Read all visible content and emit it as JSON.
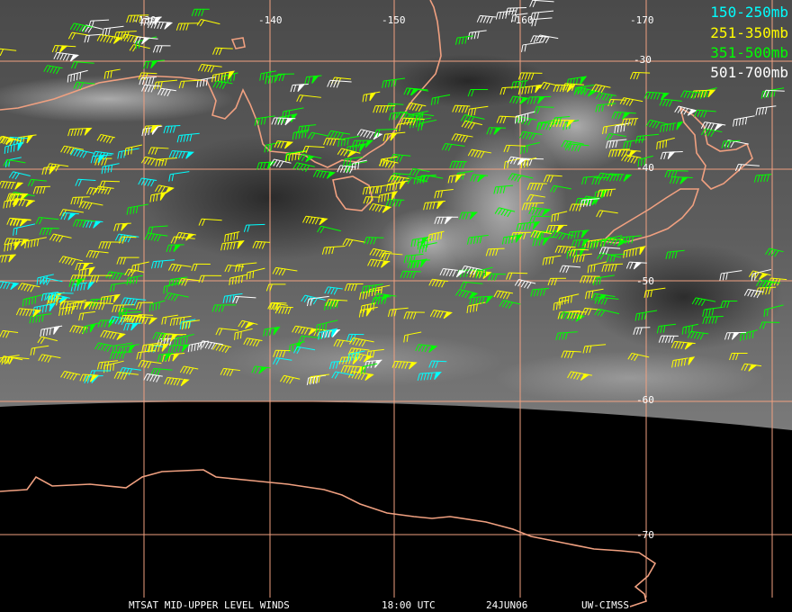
{
  "legend": [
    {
      "label": "150-250mb",
      "color": "#00ffff"
    },
    {
      "label": "251-350mb",
      "color": "#ffff00"
    },
    {
      "label": "351-500mb",
      "color": "#00ff00"
    },
    {
      "label": "501-700mb",
      "color": "#ffffff"
    }
  ],
  "longitude_labels": [
    "-130",
    "-140",
    "-150",
    "-160",
    "-170"
  ],
  "latitude_labels": [
    "-30",
    "-40",
    "-50",
    "-60",
    "-70"
  ],
  "footer": {
    "product": "MTSAT MID-UPPER LEVEL WINDS",
    "time": "18:00 UTC",
    "date": "24JUN06",
    "source": "UW-CIMSS"
  },
  "colors": {
    "grid": "#f0a080",
    "coast": "#f0a080",
    "space": "#000000"
  }
}
